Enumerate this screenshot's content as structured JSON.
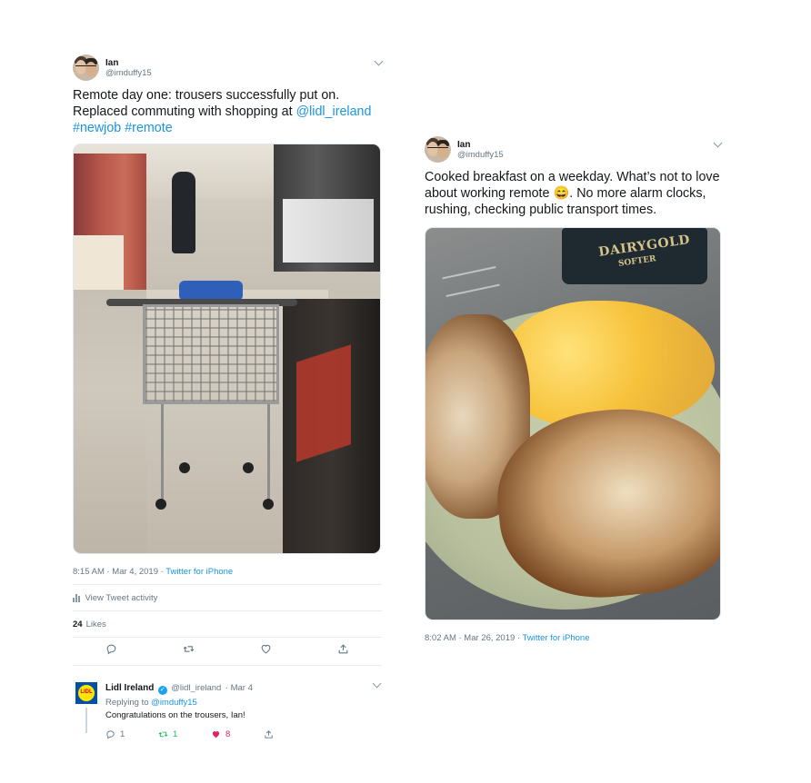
{
  "tweets": [
    {
      "name": "Ian",
      "handle": "@imduffy15",
      "text": {
        "line1": "Remote day one: trousers successfully put on.",
        "line2_before": "Replaced commuting with shopping at ",
        "mention": "@lidl_ireland",
        "hashtags": "#newjob #remote"
      },
      "timestamp": "8:15 AM · Mar 4, 2019",
      "separator": " · ",
      "source": "Twitter for iPhone",
      "activity_label": "View Tweet activity",
      "likes_count": "24",
      "likes_label": "Likes",
      "actions": [
        "reply-icon",
        "retweet-icon",
        "like-icon",
        "share-icon"
      ]
    },
    {
      "name": "Ian",
      "handle": "@imduffy15",
      "text": {
        "line1": "Cooked breakfast on a weekday. What’s not to love",
        "line2_before": "about working remote ",
        "emoji": "😄",
        "line2_after": ". No more alarm clocks,",
        "line3": "rushing, checking public transport times."
      },
      "timestamp": "8:02 AM · Mar 26, 2019",
      "separator": " · ",
      "source": "Twitter for iPhone",
      "photo_labels": {
        "brand": "DAIRYGOLD",
        "sub": "SOFTER"
      }
    }
  ],
  "reply": {
    "name": "Lidl Ireland",
    "handle": "@lidl_ireland",
    "date": "· Mar 4",
    "replying_to_label": "Replying to",
    "replying_to_handle": "@imduffy15",
    "text": "Congratulations on the trousers, Ian!",
    "logo_text": "LIDL",
    "counts": {
      "replies": "1",
      "retweets": "1",
      "likes": "8"
    }
  },
  "colors": {
    "link": "#1b95e0",
    "muted": "#657786",
    "retweet_active": "#17bf63",
    "like_active": "#e0245e"
  }
}
